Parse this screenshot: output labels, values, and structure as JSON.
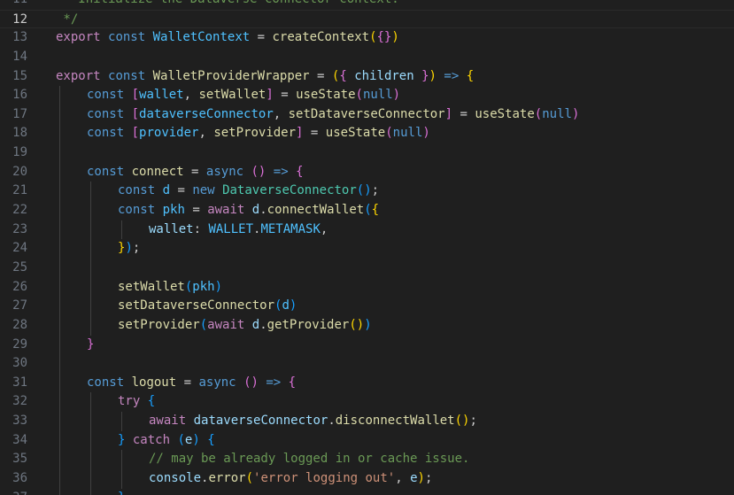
{
  "editor": {
    "current_line": 12,
    "lines": [
      {
        "num": "11",
        "indent": 0,
        "tokens": [
          {
            "t": " * Initialize the Dataverse connector context.",
            "c": "cmt"
          }
        ]
      },
      {
        "num": "12",
        "indent": 0,
        "tokens": [
          {
            "t": " */",
            "c": "cmt"
          }
        ]
      },
      {
        "num": "13",
        "indent": 0,
        "tokens": [
          {
            "t": "export",
            "c": "ctrl"
          },
          {
            "t": " ",
            "c": "p"
          },
          {
            "t": "const",
            "c": "kw"
          },
          {
            "t": " ",
            "c": "p"
          },
          {
            "t": "WalletContext",
            "c": "const"
          },
          {
            "t": " = ",
            "c": "p"
          },
          {
            "t": "createContext",
            "c": "fn"
          },
          {
            "t": "(",
            "c": "b1"
          },
          {
            "t": "{}",
            "c": "b2"
          },
          {
            "t": ")",
            "c": "b1"
          }
        ]
      },
      {
        "num": "14",
        "indent": 0,
        "tokens": []
      },
      {
        "num": "15",
        "indent": 0,
        "tokens": [
          {
            "t": "export",
            "c": "ctrl"
          },
          {
            "t": " ",
            "c": "p"
          },
          {
            "t": "const",
            "c": "kw"
          },
          {
            "t": " ",
            "c": "p"
          },
          {
            "t": "WalletProviderWrapper",
            "c": "fn"
          },
          {
            "t": " = ",
            "c": "p"
          },
          {
            "t": "(",
            "c": "b1"
          },
          {
            "t": "{",
            "c": "b2"
          },
          {
            "t": " ",
            "c": "p"
          },
          {
            "t": "children",
            "c": "var"
          },
          {
            "t": " ",
            "c": "p"
          },
          {
            "t": "}",
            "c": "b2"
          },
          {
            "t": ")",
            "c": "b1"
          },
          {
            "t": " ",
            "c": "p"
          },
          {
            "t": "=>",
            "c": "kw"
          },
          {
            "t": " ",
            "c": "p"
          },
          {
            "t": "{",
            "c": "b1"
          }
        ]
      },
      {
        "num": "16",
        "indent": 1,
        "tokens": [
          {
            "t": "const",
            "c": "kw"
          },
          {
            "t": " ",
            "c": "p"
          },
          {
            "t": "[",
            "c": "b2"
          },
          {
            "t": "wallet",
            "c": "const"
          },
          {
            "t": ", ",
            "c": "p"
          },
          {
            "t": "setWallet",
            "c": "fn"
          },
          {
            "t": "]",
            "c": "b2"
          },
          {
            "t": " = ",
            "c": "p"
          },
          {
            "t": "useState",
            "c": "fn"
          },
          {
            "t": "(",
            "c": "b2"
          },
          {
            "t": "null",
            "c": "kw"
          },
          {
            "t": ")",
            "c": "b2"
          }
        ]
      },
      {
        "num": "17",
        "indent": 1,
        "tokens": [
          {
            "t": "const",
            "c": "kw"
          },
          {
            "t": " ",
            "c": "p"
          },
          {
            "t": "[",
            "c": "b2"
          },
          {
            "t": "dataverseConnector",
            "c": "const"
          },
          {
            "t": ", ",
            "c": "p"
          },
          {
            "t": "setDataverseConnector",
            "c": "fn"
          },
          {
            "t": "]",
            "c": "b2"
          },
          {
            "t": " = ",
            "c": "p"
          },
          {
            "t": "useState",
            "c": "fn"
          },
          {
            "t": "(",
            "c": "b2"
          },
          {
            "t": "null",
            "c": "kw"
          },
          {
            "t": ")",
            "c": "b2"
          }
        ]
      },
      {
        "num": "18",
        "indent": 1,
        "tokens": [
          {
            "t": "const",
            "c": "kw"
          },
          {
            "t": " ",
            "c": "p"
          },
          {
            "t": "[",
            "c": "b2"
          },
          {
            "t": "provider",
            "c": "const"
          },
          {
            "t": ", ",
            "c": "p"
          },
          {
            "t": "setProvider",
            "c": "fn"
          },
          {
            "t": "]",
            "c": "b2"
          },
          {
            "t": " = ",
            "c": "p"
          },
          {
            "t": "useState",
            "c": "fn"
          },
          {
            "t": "(",
            "c": "b2"
          },
          {
            "t": "null",
            "c": "kw"
          },
          {
            "t": ")",
            "c": "b2"
          }
        ]
      },
      {
        "num": "19",
        "indent": 1,
        "tokens": []
      },
      {
        "num": "20",
        "indent": 1,
        "tokens": [
          {
            "t": "const",
            "c": "kw"
          },
          {
            "t": " ",
            "c": "p"
          },
          {
            "t": "connect",
            "c": "fn"
          },
          {
            "t": " = ",
            "c": "p"
          },
          {
            "t": "async",
            "c": "kw"
          },
          {
            "t": " ",
            "c": "p"
          },
          {
            "t": "()",
            "c": "b2"
          },
          {
            "t": " ",
            "c": "p"
          },
          {
            "t": "=>",
            "c": "kw"
          },
          {
            "t": " ",
            "c": "p"
          },
          {
            "t": "{",
            "c": "b2"
          }
        ]
      },
      {
        "num": "21",
        "indent": 2,
        "tokens": [
          {
            "t": "const",
            "c": "kw"
          },
          {
            "t": " ",
            "c": "p"
          },
          {
            "t": "d",
            "c": "const"
          },
          {
            "t": " = ",
            "c": "p"
          },
          {
            "t": "new",
            "c": "kw"
          },
          {
            "t": " ",
            "c": "p"
          },
          {
            "t": "DataverseConnector",
            "c": "cls"
          },
          {
            "t": "()",
            "c": "b3"
          },
          {
            "t": ";",
            "c": "p"
          }
        ]
      },
      {
        "num": "22",
        "indent": 2,
        "tokens": [
          {
            "t": "const",
            "c": "kw"
          },
          {
            "t": " ",
            "c": "p"
          },
          {
            "t": "pkh",
            "c": "const"
          },
          {
            "t": " = ",
            "c": "p"
          },
          {
            "t": "await",
            "c": "ctrl"
          },
          {
            "t": " ",
            "c": "p"
          },
          {
            "t": "d",
            "c": "var"
          },
          {
            "t": ".",
            "c": "p"
          },
          {
            "t": "connectWallet",
            "c": "fn"
          },
          {
            "t": "(",
            "c": "b3"
          },
          {
            "t": "{",
            "c": "b1"
          }
        ]
      },
      {
        "num": "23",
        "indent": 3,
        "tokens": [
          {
            "t": "wallet",
            "c": "var"
          },
          {
            "t": ": ",
            "c": "p"
          },
          {
            "t": "WALLET",
            "c": "const"
          },
          {
            "t": ".",
            "c": "p"
          },
          {
            "t": "METAMASK",
            "c": "const"
          },
          {
            "t": ",",
            "c": "p"
          }
        ]
      },
      {
        "num": "24",
        "indent": 2,
        "tokens": [
          {
            "t": "}",
            "c": "b1"
          },
          {
            "t": ")",
            "c": "b3"
          },
          {
            "t": ";",
            "c": "p"
          }
        ]
      },
      {
        "num": "25",
        "indent": 2,
        "tokens": []
      },
      {
        "num": "26",
        "indent": 2,
        "tokens": [
          {
            "t": "setWallet",
            "c": "fn"
          },
          {
            "t": "(",
            "c": "b3"
          },
          {
            "t": "pkh",
            "c": "const"
          },
          {
            "t": ")",
            "c": "b3"
          }
        ]
      },
      {
        "num": "27",
        "indent": 2,
        "tokens": [
          {
            "t": "setDataverseConnector",
            "c": "fn"
          },
          {
            "t": "(",
            "c": "b3"
          },
          {
            "t": "d",
            "c": "const"
          },
          {
            "t": ")",
            "c": "b3"
          }
        ]
      },
      {
        "num": "28",
        "indent": 2,
        "tokens": [
          {
            "t": "setProvider",
            "c": "fn"
          },
          {
            "t": "(",
            "c": "b3"
          },
          {
            "t": "await",
            "c": "ctrl"
          },
          {
            "t": " ",
            "c": "p"
          },
          {
            "t": "d",
            "c": "var"
          },
          {
            "t": ".",
            "c": "p"
          },
          {
            "t": "getProvider",
            "c": "fn"
          },
          {
            "t": "()",
            "c": "b1"
          },
          {
            "t": ")",
            "c": "b3"
          }
        ]
      },
      {
        "num": "29",
        "indent": 1,
        "tokens": [
          {
            "t": "}",
            "c": "b2"
          }
        ]
      },
      {
        "num": "30",
        "indent": 1,
        "tokens": []
      },
      {
        "num": "31",
        "indent": 1,
        "tokens": [
          {
            "t": "const",
            "c": "kw"
          },
          {
            "t": " ",
            "c": "p"
          },
          {
            "t": "logout",
            "c": "fn"
          },
          {
            "t": " = ",
            "c": "p"
          },
          {
            "t": "async",
            "c": "kw"
          },
          {
            "t": " ",
            "c": "p"
          },
          {
            "t": "()",
            "c": "b2"
          },
          {
            "t": " ",
            "c": "p"
          },
          {
            "t": "=>",
            "c": "kw"
          },
          {
            "t": " ",
            "c": "p"
          },
          {
            "t": "{",
            "c": "b2"
          }
        ]
      },
      {
        "num": "32",
        "indent": 2,
        "tokens": [
          {
            "t": "try",
            "c": "ctrl"
          },
          {
            "t": " ",
            "c": "p"
          },
          {
            "t": "{",
            "c": "b3"
          }
        ]
      },
      {
        "num": "33",
        "indent": 3,
        "tokens": [
          {
            "t": "await",
            "c": "ctrl"
          },
          {
            "t": " ",
            "c": "p"
          },
          {
            "t": "dataverseConnector",
            "c": "var"
          },
          {
            "t": ".",
            "c": "p"
          },
          {
            "t": "disconnectWallet",
            "c": "fn"
          },
          {
            "t": "()",
            "c": "b1"
          },
          {
            "t": ";",
            "c": "p"
          }
        ]
      },
      {
        "num": "34",
        "indent": 2,
        "tokens": [
          {
            "t": "}",
            "c": "b3"
          },
          {
            "t": " ",
            "c": "p"
          },
          {
            "t": "catch",
            "c": "ctrl"
          },
          {
            "t": " ",
            "c": "p"
          },
          {
            "t": "(",
            "c": "b3"
          },
          {
            "t": "e",
            "c": "var"
          },
          {
            "t": ")",
            "c": "b3"
          },
          {
            "t": " ",
            "c": "p"
          },
          {
            "t": "{",
            "c": "b3"
          }
        ]
      },
      {
        "num": "35",
        "indent": 3,
        "tokens": [
          {
            "t": "// may be already logged in or cache issue.",
            "c": "cmt"
          }
        ]
      },
      {
        "num": "36",
        "indent": 3,
        "tokens": [
          {
            "t": "console",
            "c": "var"
          },
          {
            "t": ".",
            "c": "p"
          },
          {
            "t": "error",
            "c": "fn"
          },
          {
            "t": "(",
            "c": "b1"
          },
          {
            "t": "'error logging out'",
            "c": "str"
          },
          {
            "t": ", ",
            "c": "p"
          },
          {
            "t": "e",
            "c": "var"
          },
          {
            "t": ")",
            "c": "b1"
          },
          {
            "t": ";",
            "c": "p"
          }
        ]
      },
      {
        "num": "37",
        "indent": 2,
        "tokens": [
          {
            "t": "}",
            "c": "b3"
          }
        ]
      }
    ]
  }
}
